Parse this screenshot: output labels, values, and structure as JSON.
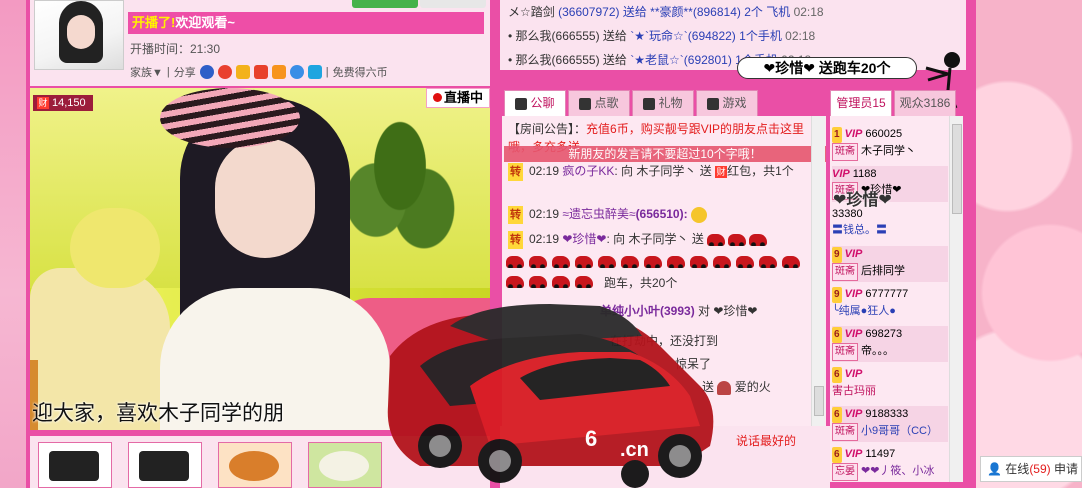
{
  "host": {
    "greeting_prefix": "开播了!",
    "greeting_suffix": "欢迎观看~",
    "start_time": "开播时间：21:30",
    "tools_family": "家族▼",
    "tools_share": "分享",
    "tools_free": "免费得六币"
  },
  "video": {
    "rich_label": "财",
    "rich_value": "14,150",
    "live_label": "直播中",
    "subtitle": "迎大家，喜欢木子同学的朋"
  },
  "ticker": {
    "lines": [
      {
        "a": "メ☆踏剑",
        "b": "(36607972) 送给 **豪颜**(896814) 2个 飞机",
        "t": "02:18"
      },
      {
        "a": "那么我(666555) 送给",
        "b": "`★`玩命☆`(694822) 1个手机",
        "t": "02:18"
      },
      {
        "a": "那么我(666555) 送给",
        "b": "`★老鼠☆`(692801) 1个手机",
        "t": "02:18"
      }
    ]
  },
  "bubble": {
    "text": "❤珍惜❤ 送跑车20个"
  },
  "chat_tabs": [
    "公聊",
    "点歌",
    "礼物",
    "游戏"
  ],
  "user_tabs": [
    "管理员15",
    "观众3186"
  ],
  "chat": {
    "notice_label": "【房间公告】：",
    "notice_text": "充值6币，购买靓号跟VIP的朋友点击这里哦，多充多送",
    "limit": "新朋友的发言请不要超过10个字哦！",
    "lines": [
      {
        "time": "02:19",
        "user": "疯の子KK",
        "act": ": 向 木子同学丶 送",
        "item": "红包，共1个"
      },
      {
        "time": "02:19",
        "user": "≈遗忘虫醉美≈",
        "num": "(656510):"
      },
      {
        "time": "02:19",
        "user": "❤珍惜❤",
        "act": ": 向 木子同学丶 送"
      }
    ],
    "car_total": "跑车，共20个",
    "line4_user": "单纯小小叶(3993)",
    "line4_act": "对 ❤珍惜❤",
    "line5": "在打劫中，还没打到",
    "line6": "惊呆了",
    "line7_act": "送",
    "line7_item": "爱的火",
    "bottom_text": "说话最好的"
  },
  "users": [
    {
      "lvl": "1",
      "vip": "VIP",
      "name": "660025",
      "cat": "斑斋",
      "sub": "木子同学丶"
    },
    {
      "lvl": "",
      "vip": "VIP",
      "name": "1188",
      "cat": "斑斋",
      "sub": "❤珍惜❤"
    },
    {
      "lvl": "",
      "vip": "",
      "name": "33380",
      "cat": "",
      "sub": "〓钱总。〓"
    },
    {
      "lvl": "9",
      "vip": "VIP",
      "name": "",
      "cat": "斑斋",
      "sub": "后排同学"
    },
    {
      "lvl": "9",
      "vip": "VIP",
      "name": "6777777",
      "cat": "",
      "sub": "╰纯属●狂人●"
    },
    {
      "lvl": "6",
      "vip": "VIP",
      "name": "698273",
      "cat": "斑斋",
      "sub": "帝。。。"
    },
    {
      "lvl": "6",
      "vip": "VIP",
      "name": "",
      "cat": "",
      "sub": "害古玛丽"
    },
    {
      "lvl": "6",
      "vip": "VIP",
      "name": "9188333",
      "cat": "斑斋",
      "sub": "小9哥哥（CC）"
    },
    {
      "lvl": "6",
      "vip": "VIP",
      "name": "11497",
      "cat": "忘晏",
      "sub": "❤❤丿筱、小冰"
    }
  ],
  "float_name": "❤珍惜❤",
  "online": {
    "label": "在线",
    "count": "(59)",
    "extra": "申请"
  },
  "colors": {
    "frame": "#ea4fa6",
    "panel": "#fbe3ef",
    "accent": "#e31c1c"
  }
}
